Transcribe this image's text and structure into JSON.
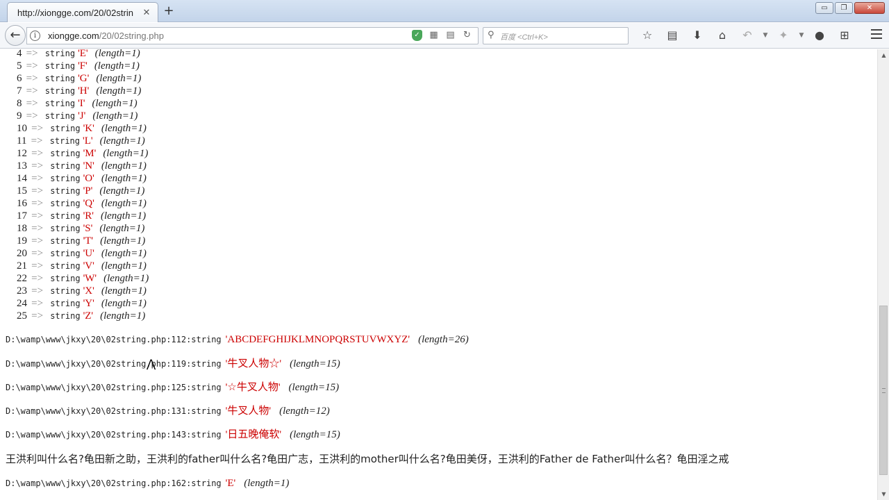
{
  "browser": {
    "tab_title": "http://xiongge.com/20/02strin",
    "tab_close": "✕",
    "new_tab": "+",
    "window_buttons": [
      "▭",
      "❐",
      "✕"
    ],
    "url_host": "xiongge.com",
    "url_path": "/20/02string.php",
    "search_placeholder": "百度 <Ctrl+K>",
    "toolbar_icons": [
      "star-icon",
      "reader-icon",
      "download-icon",
      "home-icon",
      "undo-icon",
      "dropdown-icon",
      "extension-icon",
      "dropdown-icon",
      "chat-icon",
      "crop-icon",
      "menu-icon"
    ]
  },
  "dump_rows": [
    {
      "index": "4",
      "arrow": "=>",
      "type": "string",
      "value": "'E'",
      "length": "(length=1)"
    },
    {
      "index": "5",
      "arrow": "=>",
      "type": "string",
      "value": "'F'",
      "length": "(length=1)"
    },
    {
      "index": "6",
      "arrow": "=>",
      "type": "string",
      "value": "'G'",
      "length": "(length=1)"
    },
    {
      "index": "7",
      "arrow": "=>",
      "type": "string",
      "value": "'H'",
      "length": "(length=1)"
    },
    {
      "index": "8",
      "arrow": "=>",
      "type": "string",
      "value": "'I'",
      "length": "(length=1)"
    },
    {
      "index": "9",
      "arrow": "=>",
      "type": "string",
      "value": "'J'",
      "length": "(length=1)"
    },
    {
      "index": "10",
      "arrow": "=>",
      "type": "string",
      "value": "'K'",
      "length": "(length=1)"
    },
    {
      "index": "11",
      "arrow": "=>",
      "type": "string",
      "value": "'L'",
      "length": "(length=1)"
    },
    {
      "index": "12",
      "arrow": "=>",
      "type": "string",
      "value": "'M'",
      "length": "(length=1)"
    },
    {
      "index": "13",
      "arrow": "=>",
      "type": "string",
      "value": "'N'",
      "length": "(length=1)"
    },
    {
      "index": "14",
      "arrow": "=>",
      "type": "string",
      "value": "'O'",
      "length": "(length=1)"
    },
    {
      "index": "15",
      "arrow": "=>",
      "type": "string",
      "value": "'P'",
      "length": "(length=1)"
    },
    {
      "index": "16",
      "arrow": "=>",
      "type": "string",
      "value": "'Q'",
      "length": "(length=1)"
    },
    {
      "index": "17",
      "arrow": "=>",
      "type": "string",
      "value": "'R'",
      "length": "(length=1)"
    },
    {
      "index": "18",
      "arrow": "=>",
      "type": "string",
      "value": "'S'",
      "length": "(length=1)"
    },
    {
      "index": "19",
      "arrow": "=>",
      "type": "string",
      "value": "'T'",
      "length": "(length=1)"
    },
    {
      "index": "20",
      "arrow": "=>",
      "type": "string",
      "value": "'U'",
      "length": "(length=1)"
    },
    {
      "index": "21",
      "arrow": "=>",
      "type": "string",
      "value": "'V'",
      "length": "(length=1)"
    },
    {
      "index": "22",
      "arrow": "=>",
      "type": "string",
      "value": "'W'",
      "length": "(length=1)"
    },
    {
      "index": "23",
      "arrow": "=>",
      "type": "string",
      "value": "'X'",
      "length": "(length=1)"
    },
    {
      "index": "24",
      "arrow": "=>",
      "type": "string",
      "value": "'Y'",
      "length": "(length=1)"
    },
    {
      "index": "25",
      "arrow": "=>",
      "type": "string",
      "value": "'Z'",
      "length": "(length=1)"
    }
  ],
  "file_rows": [
    {
      "path": "D:\\wamp\\www\\jkxy\\20\\02string.php:112:string",
      "value": "'ABCDEFGHIJKLMNOPQRSTUVWXYZ'",
      "length": "(length=26)"
    },
    {
      "path": "D:\\wamp\\www\\jkxy\\20\\02string.php:119:string",
      "value": "'牛叉人物☆'",
      "length": "(length=15)"
    },
    {
      "path": "D:\\wamp\\www\\jkxy\\20\\02string.php:125:string",
      "value": "'☆牛叉人物'",
      "length": "(length=15)"
    },
    {
      "path": "D:\\wamp\\www\\jkxy\\20\\02string.php:131:string",
      "value": "'牛叉人物'",
      "length": "(length=12)"
    },
    {
      "path": "D:\\wamp\\www\\jkxy\\20\\02string.php:143:string",
      "value": "'日五晚俺软'",
      "length": "(length=15)"
    }
  ],
  "plain_text": "王洪利叫什么名?龟田新之助，王洪利的father叫什么名?龟田广志，王洪利的mother叫什么名?龟田美伢，王洪利的Father de Father叫什么名？龟田淫之戒",
  "last_row": {
    "path": "D:\\wamp\\www\\jkxy\\20\\02string.php:162:string",
    "value": "'E'",
    "length": "(length=1)"
  },
  "colors": {
    "string_value": "#cc0000",
    "shield": "#4aa75a"
  }
}
